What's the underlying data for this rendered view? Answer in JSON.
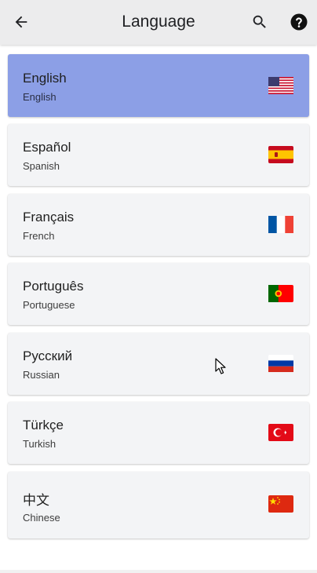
{
  "header": {
    "title": "Language",
    "back_icon": "arrow-left-icon",
    "search_icon": "search-icon",
    "help_icon": "help-circle-icon"
  },
  "languages": [
    {
      "name": "English",
      "subtitle": "English",
      "flag": "flag-us",
      "selected": true
    },
    {
      "name": "Español",
      "subtitle": "Spanish",
      "flag": "flag-es",
      "selected": false
    },
    {
      "name": "Français",
      "subtitle": "French",
      "flag": "flag-fr",
      "selected": false
    },
    {
      "name": "Português",
      "subtitle": "Portuguese",
      "flag": "flag-pt",
      "selected": false
    },
    {
      "name": "Русский",
      "subtitle": "Russian",
      "flag": "flag-ru",
      "selected": false
    },
    {
      "name": "Türkçe",
      "subtitle": "Turkish",
      "flag": "flag-tr",
      "selected": false
    },
    {
      "name": "中文",
      "subtitle": "Chinese",
      "flag": "flag-cn",
      "selected": false
    }
  ],
  "colors": {
    "selected_card": "#8c9fe6",
    "card": "#f3f4f6",
    "appbar": "#ececed"
  }
}
